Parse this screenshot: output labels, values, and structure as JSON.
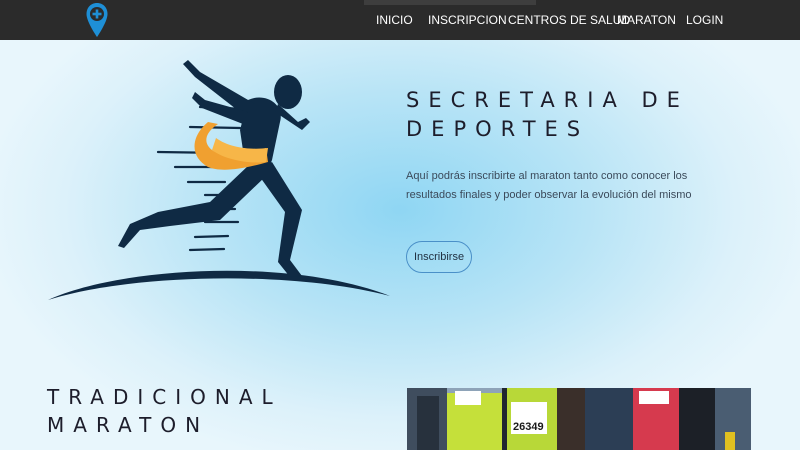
{
  "nav": {
    "items": [
      "INICIO",
      "INSCRIPCION",
      "CENTROS DE SALUD",
      "MARATON",
      "LOGIN"
    ]
  },
  "hero": {
    "title_line1": "SECRETARIA DE",
    "title_line2": "DEPORTES",
    "description": "Aquí podrás inscribirte al maraton tanto como conocer los resultados finales y poder observar la evolución del mismo",
    "cta_label": "Inscribirse"
  },
  "section": {
    "title_line1": "TRADICIONAL",
    "title_line2": "MARATON"
  },
  "photo": {
    "bib_number": "26349"
  },
  "colors": {
    "navbar": "#2b2b2b",
    "logo": "#1e8fd6",
    "runner": "#0f2a44",
    "ribbon": "#f0a030",
    "button_border": "#4a90c8"
  }
}
